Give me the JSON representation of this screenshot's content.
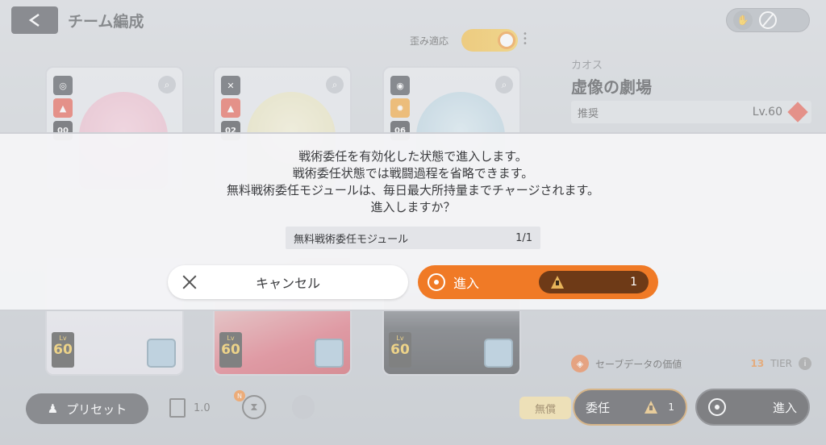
{
  "header": {
    "title": "チーム編成",
    "distortion_label": "歪み適応"
  },
  "cards": [
    {
      "badge_number": "00",
      "level_label": "Lv",
      "level": "60"
    },
    {
      "badge_number": "02",
      "level_label": "Lv",
      "level": "60"
    },
    {
      "badge_number": "06",
      "level_label": "Lv",
      "level": "60"
    }
  ],
  "stage": {
    "category": "カオス",
    "title": "虚像の劇場",
    "recommended_label": "推奨",
    "recommended_level": "Lv.60"
  },
  "save_data": {
    "label": "セーブデータの価値",
    "value": "13",
    "unit": "TIER"
  },
  "bottom": {
    "preset_label": "プリセット",
    "speed": "1.0",
    "new_badge": "N",
    "free_label": "無償",
    "delegate_label": "委任",
    "delegate_count": "1",
    "enter_label": "進入"
  },
  "dialog": {
    "lines": [
      "戦術委任を有効化した状態で進入します。",
      "戦術委任状態では戦闘過程を省略できます。",
      "無料戦術委任モジュールは、毎日最大所持量までチャージされます。",
      "進入しますか？"
    ],
    "module_label": "無料戦術委任モジュール",
    "module_count": "1/1",
    "cancel_label": "キャンセル",
    "confirm_label": "進入",
    "confirm_count": "1"
  },
  "colors": {
    "accent_orange": "#f07a26",
    "dark_button": "#3e4046"
  }
}
